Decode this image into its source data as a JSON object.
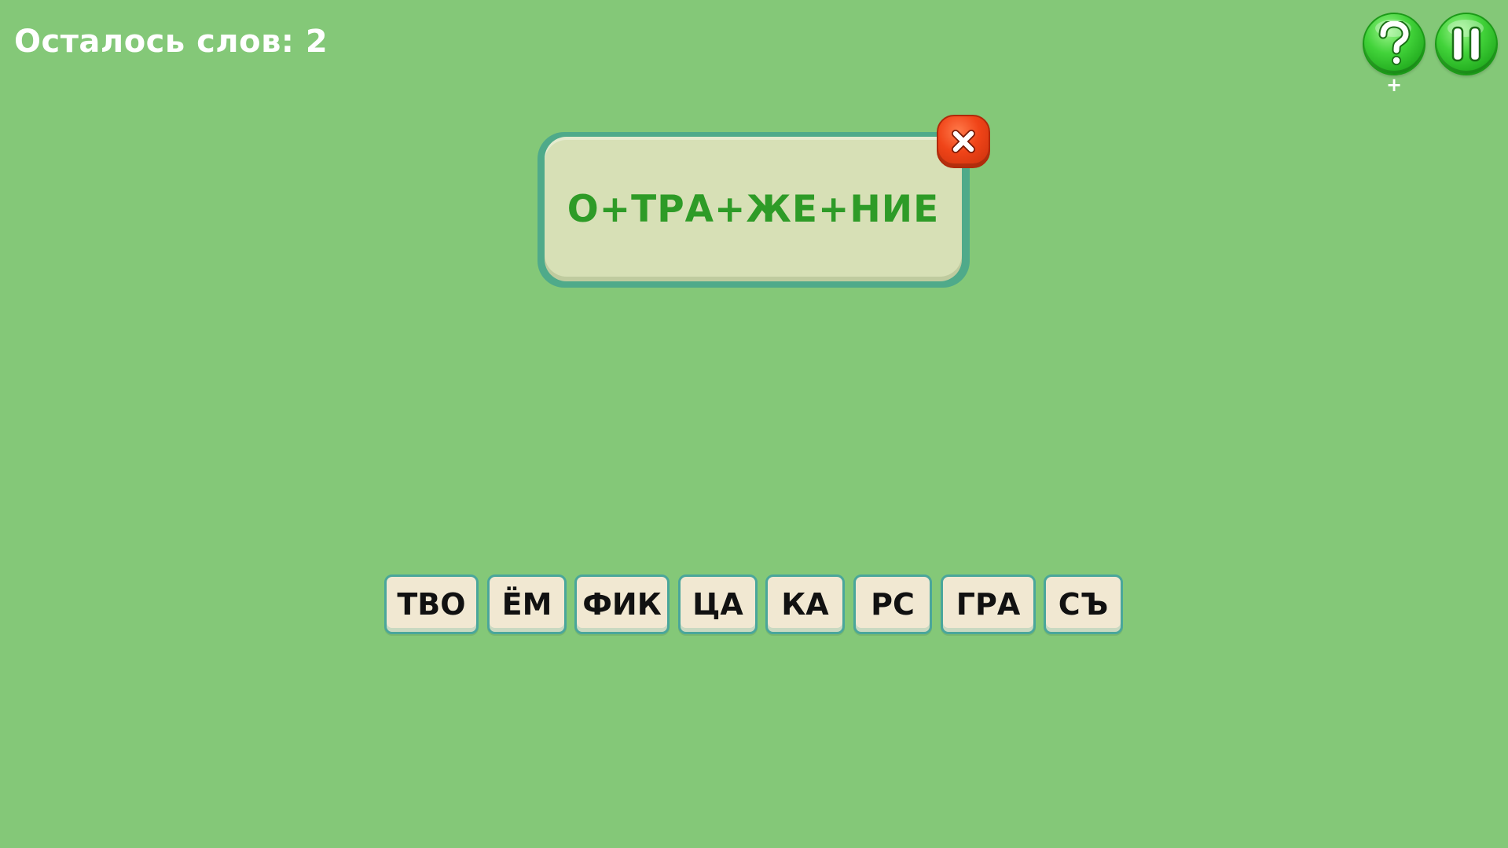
{
  "header": {
    "words_left": "Осталось слов: 2"
  },
  "controls": {
    "help_icon": "question-mark-icon",
    "help_plus": "+",
    "pause_icon": "pause-icon",
    "close_icon": "close-x-icon"
  },
  "word_panel": {
    "word": "О+ТРА+ЖЕ+НИЕ"
  },
  "tiles": [
    "ТВО",
    "ЁМ",
    "ФИК",
    "ЦА",
    "КА",
    "РС",
    "ГРА",
    "СЪ"
  ],
  "colors": {
    "background": "#84c878",
    "word_text": "#2e9b27",
    "tile_fill": "#f1e8d2",
    "tile_border": "#4aa69b",
    "button_green": "#42d33a",
    "close_red": "#f04418"
  }
}
